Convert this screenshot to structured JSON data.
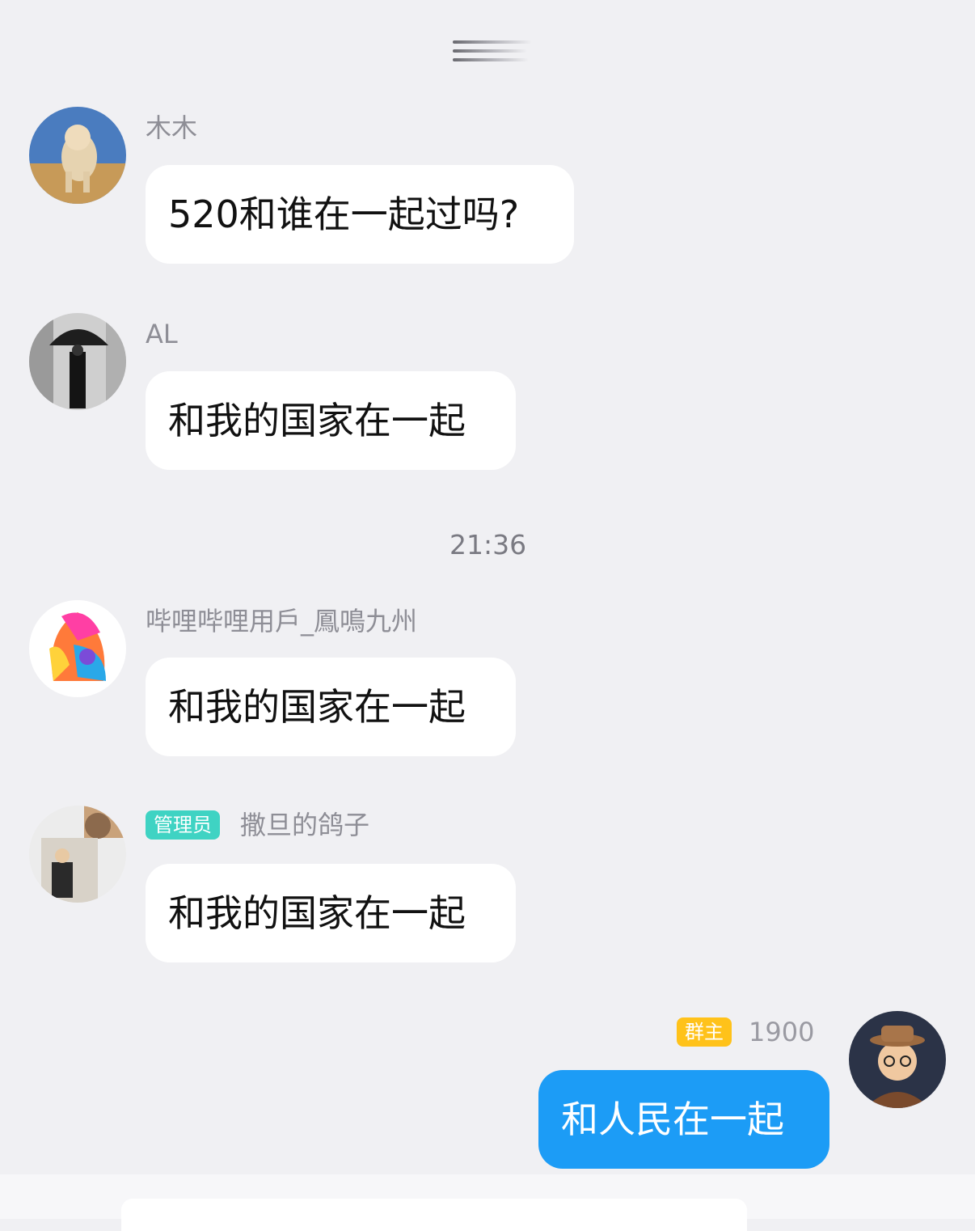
{
  "messages": [
    {
      "sender": "木木",
      "text": "520和谁在一起过吗?"
    },
    {
      "sender": "AL",
      "text": "和我的国家在一起"
    },
    {
      "sender": "哔哩哔哩用戶_鳳鳴九州",
      "text": "和我的国家在一起"
    },
    {
      "sender": "撒旦的鸽子",
      "badge": "管理员",
      "text": "和我的国家在一起"
    },
    {
      "sender": "1900",
      "badge": "群主",
      "text": "和人民在一起"
    }
  ],
  "timestamp": "21:36",
  "colors": {
    "background": "#f0f0f3",
    "my_bubble": "#1c9cf6",
    "admin_badge": "#3fd3c3",
    "owner_badge": "#ffc21a"
  }
}
